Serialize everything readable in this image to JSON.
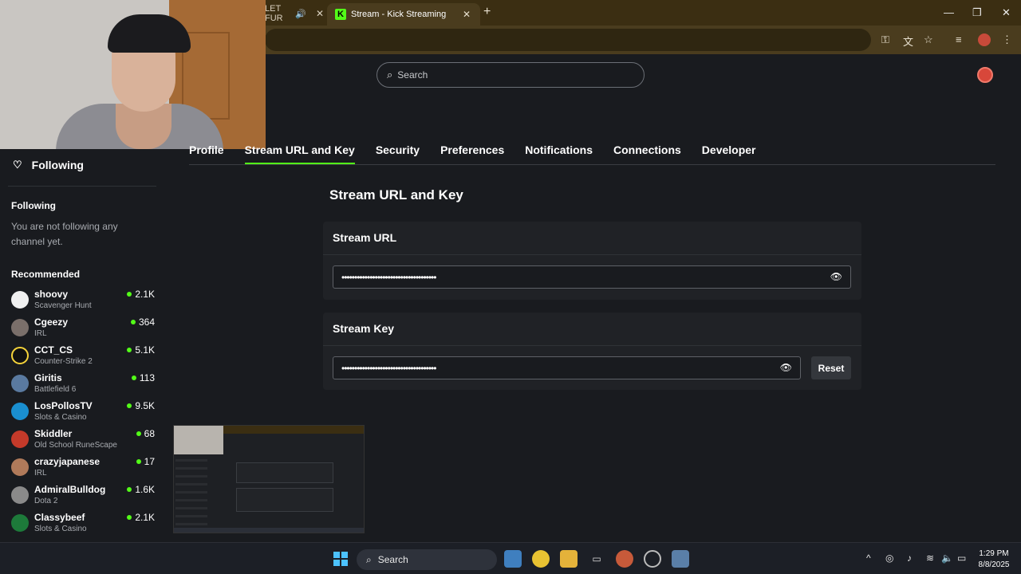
{
  "browser": {
    "prev_tab_title": "LET FUR",
    "active_tab_title": "Stream - Kick Streaming",
    "favicon_letter": "K"
  },
  "site": {
    "search_placeholder": "Search"
  },
  "sidebar": {
    "nav_following": "Following",
    "following_heading": "Following",
    "following_empty": "You are not following any channel yet.",
    "recommended_heading": "Recommended",
    "channels": [
      {
        "name": "shoovy",
        "category": "Scavenger Hunt",
        "viewers": "2.1K",
        "color": "#f0f0f0"
      },
      {
        "name": "Cgeezy",
        "category": "IRL",
        "viewers": "364",
        "color": "#7a6f6a"
      },
      {
        "name": "CCT_CS",
        "category": "Counter-Strike 2",
        "viewers": "5.1K",
        "color": "#111111"
      },
      {
        "name": "Giritis",
        "category": "Battlefield 6",
        "viewers": "113",
        "color": "#5a7aa0"
      },
      {
        "name": "LosPollosTV",
        "category": "Slots & Casino",
        "viewers": "9.5K",
        "color": "#1a8fd0"
      },
      {
        "name": "Skiddler",
        "category": "Old School RuneScape",
        "viewers": "68",
        "color": "#c43a2a"
      },
      {
        "name": "crazyjapanese",
        "category": "IRL",
        "viewers": "17",
        "color": "#b07a5a"
      },
      {
        "name": "AdmiralBulldog",
        "category": "Dota 2",
        "viewers": "1.6K",
        "color": "#8a8a8a"
      },
      {
        "name": "Classybeef",
        "category": "Slots & Casino",
        "viewers": "2.1K",
        "color": "#1d7a3a"
      }
    ]
  },
  "settings": {
    "tabs": [
      "Profile",
      "Stream URL and Key",
      "Security",
      "Preferences",
      "Notifications",
      "Connections",
      "Developer"
    ],
    "active_tab": "Stream URL and Key",
    "page_title": "Stream URL and Key",
    "stream_url": {
      "title": "Stream URL",
      "masked_value": "•••••••••••••••••••••••••••••••••••••"
    },
    "stream_key": {
      "title": "Stream Key",
      "masked_value": "•••••••••••••••••••••••••••••••••••••",
      "reset_label": "Reset"
    }
  },
  "taskbar": {
    "search_label": "Search",
    "time": "1:29 PM",
    "date": "8/8/2025"
  },
  "colors": {
    "accent": "#53fc18",
    "background": "#191b1f",
    "card": "#202226"
  }
}
